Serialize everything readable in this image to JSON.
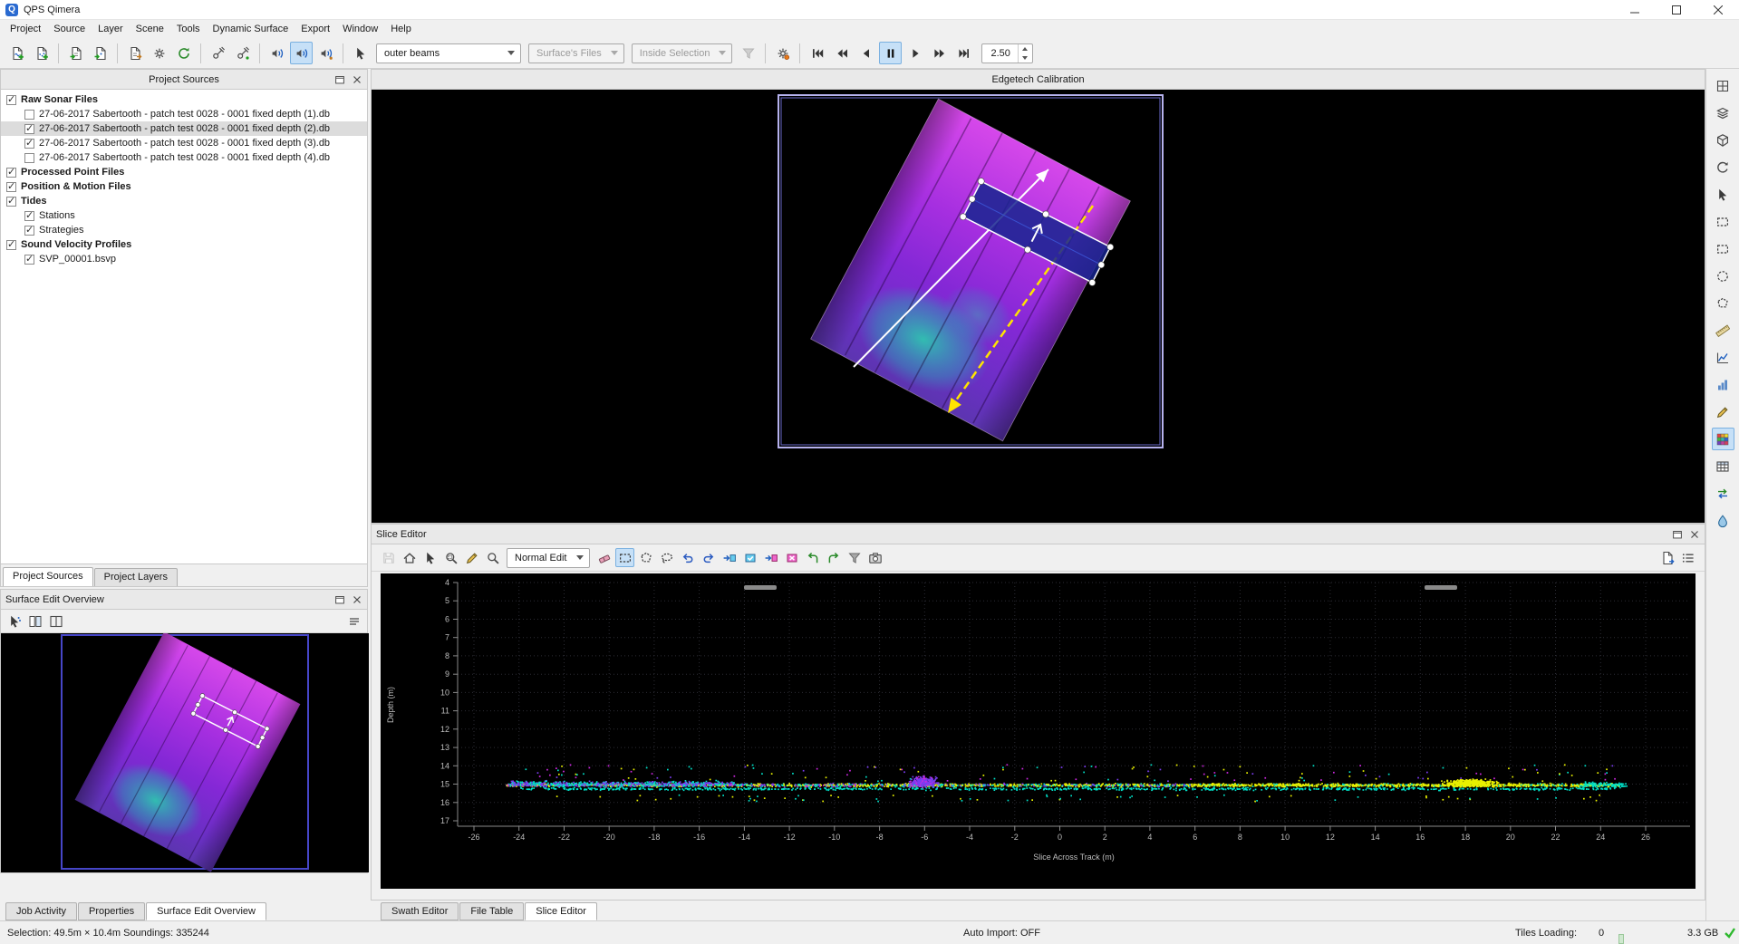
{
  "window": {
    "title": "QPS Qimera"
  },
  "menu": {
    "items": [
      "Project",
      "Source",
      "Layer",
      "Scene",
      "Tools",
      "Dynamic Surface",
      "Export",
      "Window",
      "Help"
    ]
  },
  "toolbar": {
    "icon_groups": [
      [
        {
          "name": "add-raw-sonar-icon"
        },
        {
          "name": "add-processed-points-icon"
        }
      ],
      [
        {
          "name": "import-raw-icon"
        },
        {
          "name": "import-processed-icon"
        }
      ],
      [
        {
          "name": "export-files-icon"
        },
        {
          "name": "processing-settings-icon"
        },
        {
          "name": "refresh-icon"
        }
      ],
      [
        {
          "name": "satellite-uncorrected-icon"
        },
        {
          "name": "satellite-corrected-icon"
        }
      ],
      [
        {
          "name": "svp-editor-icon"
        },
        {
          "name": "svp-apply-icon",
          "active": true
        },
        {
          "name": "svp-manager-icon"
        }
      ],
      [
        {
          "name": "pointer-mode-icon"
        }
      ]
    ],
    "combos": [
      {
        "value": "outer beams",
        "enabled": true
      },
      {
        "value": "Surface's Files",
        "enabled": false
      },
      {
        "value": "Inside Selection",
        "enabled": false
      }
    ],
    "filter_icon": {
      "name": "slice-filter-icon",
      "disabled": true
    },
    "auto_icon": {
      "name": "auto-processing-icon"
    },
    "playback": [
      {
        "name": "skip-start-button"
      },
      {
        "name": "rewind-button"
      },
      {
        "name": "step-back-button"
      },
      {
        "name": "pause-button",
        "active": true
      },
      {
        "name": "play-button"
      },
      {
        "name": "fast-forward-button"
      },
      {
        "name": "skip-end-button"
      }
    ],
    "interval_value": "2.50"
  },
  "project_sources": {
    "title": "Project Sources",
    "tree": [
      {
        "label": "Raw Sonar Files",
        "level": 0,
        "checked": true,
        "bold": true
      },
      {
        "label": "27-06-2017 Sabertooth - patch test 0028 - 0001 fixed depth (1).db",
        "level": 1,
        "checked": false
      },
      {
        "label": "27-06-2017 Sabertooth - patch test 0028 - 0001 fixed depth (2).db",
        "level": 1,
        "checked": true,
        "selected": true
      },
      {
        "label": "27-06-2017 Sabertooth - patch test 0028 - 0001 fixed depth (3).db",
        "level": 1,
        "checked": true
      },
      {
        "label": "27-06-2017 Sabertooth - patch test 0028 - 0001 fixed depth (4).db",
        "level": 1,
        "checked": false
      },
      {
        "label": "Processed Point Files",
        "level": 0,
        "checked": true,
        "bold": true
      },
      {
        "label": "Position & Motion Files",
        "level": 0,
        "checked": true,
        "bold": true
      },
      {
        "label": "Tides",
        "level": 0,
        "checked": true,
        "bold": true
      },
      {
        "label": "Stations",
        "level": 1,
        "checked": true
      },
      {
        "label": "Strategies",
        "level": 1,
        "checked": true
      },
      {
        "label": "Sound Velocity Profiles",
        "level": 0,
        "checked": true,
        "bold": true
      },
      {
        "label": "SVP_00001.bsvp",
        "level": 1,
        "checked": true
      }
    ],
    "tabs": [
      {
        "label": "Project Sources",
        "selected": true
      },
      {
        "label": "Project Layers",
        "selected": false
      }
    ]
  },
  "surface_edit_overview": {
    "title": "Surface Edit Overview",
    "toolbar_icons": [
      {
        "name": "select-points-icon"
      },
      {
        "name": "grid-compare-icon"
      },
      {
        "name": "split-view-icon"
      }
    ]
  },
  "scene": {
    "title": "Edgetech Calibration"
  },
  "slice_editor": {
    "title": "Slice Editor",
    "mode_combo": "Normal Edit",
    "toolbar_left": [
      {
        "name": "save-icon",
        "disabled": true
      },
      {
        "name": "home-icon"
      },
      {
        "name": "pointer-icon"
      },
      {
        "name": "zoom-select-icon"
      },
      {
        "name": "pencil-icon"
      },
      {
        "name": "magnifier-icon"
      }
    ],
    "toolbar_right": [
      {
        "name": "eraser-icon"
      },
      {
        "name": "rect-select-icon",
        "active": true
      },
      {
        "name": "polygon-select-icon"
      },
      {
        "name": "lasso-select-icon"
      },
      {
        "name": "undo-icon"
      },
      {
        "name": "redo-icon"
      },
      {
        "name": "accept-forward-icon"
      },
      {
        "name": "accept-selection-icon"
      },
      {
        "name": "reject-forward-icon"
      },
      {
        "name": "reject-selection-icon"
      },
      {
        "name": "turn-left-icon"
      },
      {
        "name": "turn-right-icon"
      },
      {
        "name": "slice-filter-icon"
      },
      {
        "name": "camera-icon"
      }
    ],
    "corner_icons": [
      {
        "name": "export-icon"
      },
      {
        "name": "list-icon"
      }
    ],
    "chart": {
      "type": "scatter",
      "xlabel": "Slice Across Track (m)",
      "ylabel": "Depth (m)",
      "x_ticks": [
        -26,
        -24,
        -22,
        -20,
        -18,
        -16,
        -14,
        -12,
        -10,
        -8,
        -6,
        -4,
        -2,
        0,
        2,
        4,
        6,
        8,
        10,
        12,
        14,
        16,
        18,
        20,
        22,
        24,
        26
      ],
      "y_ticks": [
        4,
        5,
        6,
        7,
        8,
        9,
        10,
        11,
        12,
        13,
        14,
        15,
        16,
        17
      ],
      "x_range": [
        -27.5,
        27.5
      ],
      "y_range": [
        4,
        17.8
      ],
      "band_depth": 15,
      "colors": {
        "yellow": "#e8f000",
        "cyan": "#00e0c8",
        "purple": "#7a3cf0",
        "magenta": "#cc28e0"
      }
    }
  },
  "right_toolbar": {
    "icons": [
      {
        "name": "view-grid-icon"
      },
      {
        "name": "layers-icon"
      },
      {
        "name": "view-3d-icon"
      },
      {
        "name": "rotate-view-icon"
      },
      {
        "name": "pointer-select-icon"
      },
      {
        "name": "rect-select-icon"
      },
      {
        "name": "dashed-rect-select-icon"
      },
      {
        "name": "circle-select-icon"
      },
      {
        "name": "polygon-select-icon"
      },
      {
        "name": "measure-icon"
      },
      {
        "name": "profile-icon"
      },
      {
        "name": "histogram-icon"
      },
      {
        "name": "pencil-icon"
      },
      {
        "name": "surface-edit-icon",
        "active": true
      },
      {
        "name": "spreadsheet-icon"
      },
      {
        "name": "swap-layers-icon"
      },
      {
        "name": "water-column-icon"
      }
    ]
  },
  "bottom_tabs": {
    "left": [
      {
        "label": "Job Activity",
        "selected": false
      },
      {
        "label": "Properties",
        "selected": false
      },
      {
        "label": "Surface Edit Overview",
        "selected": true
      }
    ],
    "main": [
      {
        "label": "Swath Editor",
        "selected": false
      },
      {
        "label": "File Table",
        "selected": false
      },
      {
        "label": "Slice Editor",
        "selected": true
      }
    ]
  },
  "status": {
    "selection": "Selection: 49.5m × 10.4m  Soundings: 335244",
    "auto_import": "Auto Import: OFF",
    "tiles_label": "Tiles Loading:",
    "tiles_value": "0",
    "memory": "3.3 GB",
    "segments_total": 10,
    "segments_on": 4
  }
}
